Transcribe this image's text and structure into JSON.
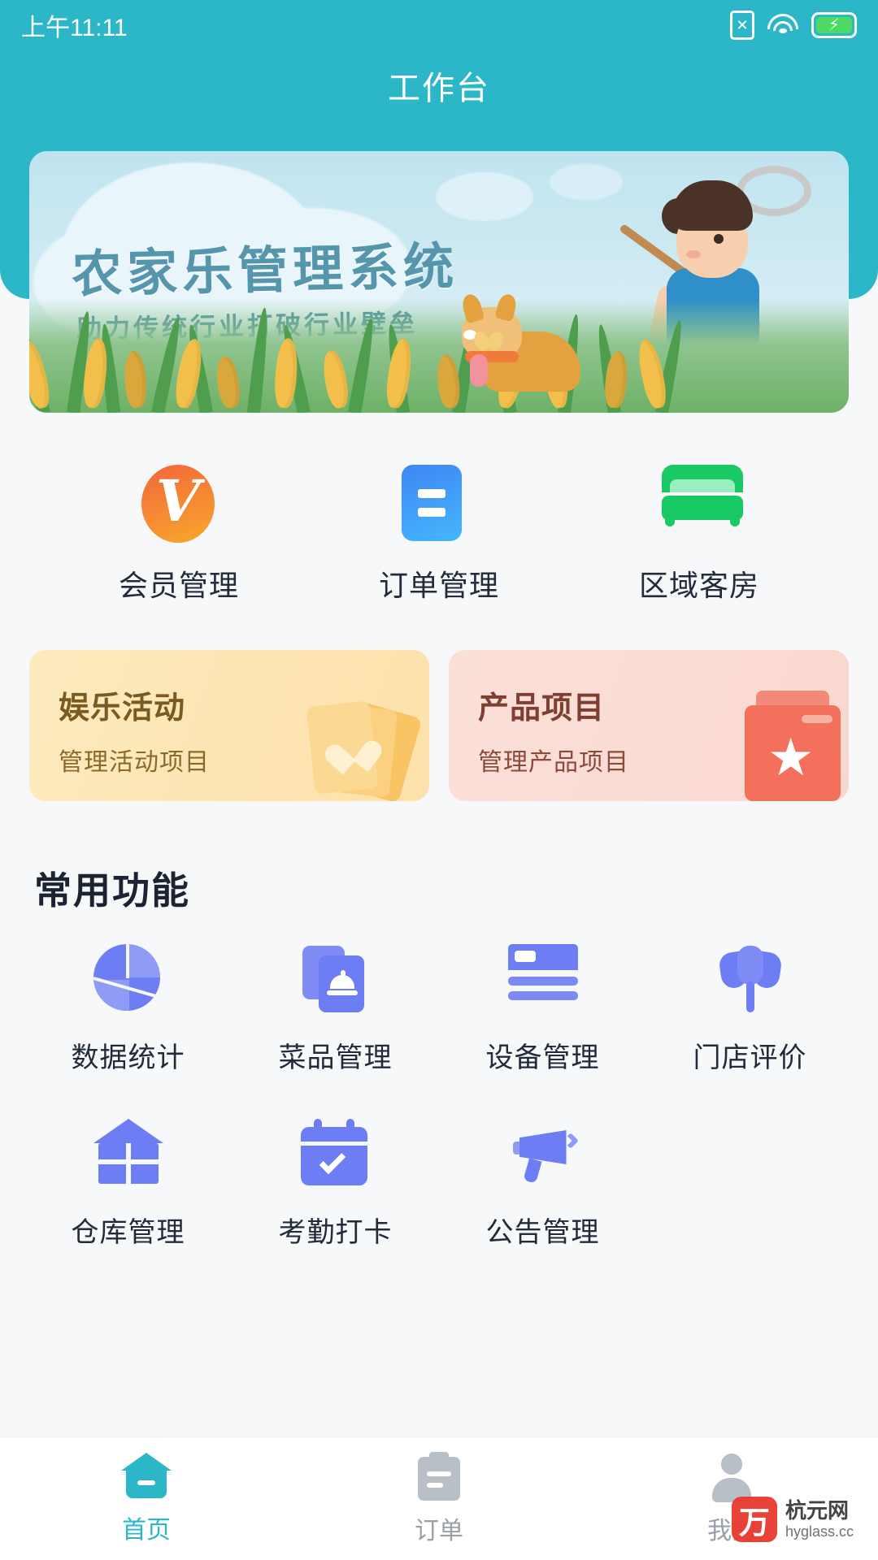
{
  "statusbar": {
    "time": "上午11:11",
    "sim_icon": "sim-card-x-icon",
    "wifi_icon": "wifi-icon",
    "battery_icon": "battery-charging-icon",
    "battery_glyph": "⚡"
  },
  "header": {
    "title": "工作台",
    "accent_color": "#2BB7C8"
  },
  "banner": {
    "title": "农家乐管理系统",
    "subtitle": "助力传统行业打破行业壁垒"
  },
  "quick_access": [
    {
      "label": "会员管理",
      "icon": "member-v-icon",
      "color": "#F58B33",
      "glyph": "V"
    },
    {
      "label": "订单管理",
      "icon": "order-list-icon",
      "color": "#3E86F5"
    },
    {
      "label": "区域客房",
      "icon": "bed-room-icon",
      "color": "#18C964"
    }
  ],
  "feature_cards": [
    {
      "title": "娱乐活动",
      "subtitle": "管理活动项目",
      "icon": "heart-cards-icon",
      "bg_color": "#FDEBC0",
      "text_color": "#7A5A20"
    },
    {
      "title": "产品项目",
      "subtitle": "管理产品项目",
      "icon": "star-folder-icon",
      "bg_color": "#FBE0D9",
      "text_color": "#7E3F33"
    }
  ],
  "section": {
    "title": "常用功能"
  },
  "functions": [
    {
      "label": "数据统计",
      "icon": "pie-chart-icon",
      "color": "#6D7DF3"
    },
    {
      "label": "菜品管理",
      "icon": "dish-cards-icon",
      "color": "#6D7DF3"
    },
    {
      "label": "设备管理",
      "icon": "device-card-icon",
      "color": "#6D7DF3"
    },
    {
      "label": "门店评价",
      "icon": "tulip-flower-icon",
      "color": "#6D7DF3"
    },
    {
      "label": "仓库管理",
      "icon": "warehouse-icon",
      "color": "#6D7DF3"
    },
    {
      "label": "考勤打卡",
      "icon": "calendar-check-icon",
      "color": "#6D7DF3"
    },
    {
      "label": "公告管理",
      "icon": "megaphone-icon",
      "color": "#6D7DF3"
    }
  ],
  "tabbar": [
    {
      "label": "首页",
      "icon": "home-icon",
      "active": true
    },
    {
      "label": "订单",
      "icon": "clipboard-icon",
      "active": false
    },
    {
      "label": "我的",
      "icon": "person-icon",
      "active": false
    }
  ],
  "watermark": {
    "logo": "万",
    "name": "杭元网",
    "url": "hyglass.cc"
  }
}
